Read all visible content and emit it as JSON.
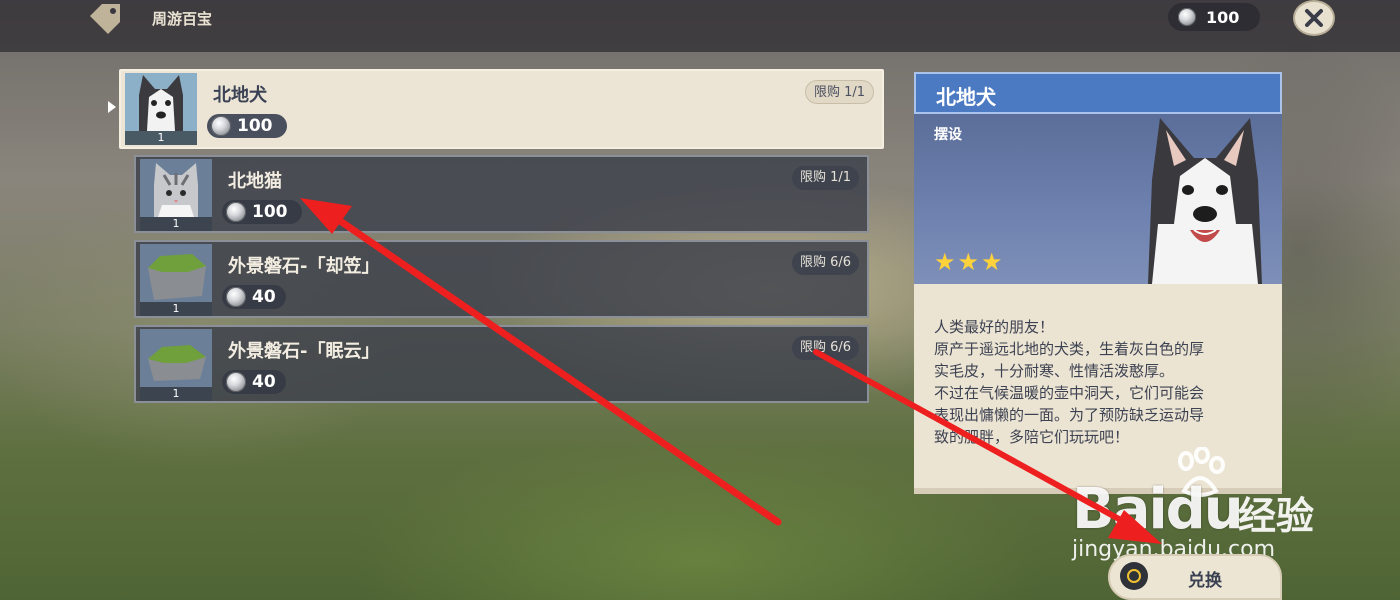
{
  "header": {
    "shop_title": "周游百宝",
    "currency_amount": "100",
    "icons": {
      "tag": "price-tag-icon",
      "coin": "silver-coin-icon",
      "close": "close-icon"
    }
  },
  "items": [
    {
      "name": "北地犬",
      "price": "100",
      "limit": "限购 1/1",
      "count": "1",
      "selected": true
    },
    {
      "name": "北地猫",
      "price": "100",
      "limit": "限购 1/1",
      "count": "1",
      "selected": false
    },
    {
      "name": "外景磐石-「却笠」",
      "price": "40",
      "limit": "限购 6/6",
      "count": "1",
      "selected": false
    },
    {
      "name": "外景磐石-「眠云」",
      "price": "40",
      "limit": "限购 6/6",
      "count": "1",
      "selected": false
    }
  ],
  "detail": {
    "title": "北地犬",
    "category": "摆设",
    "stars": "★★★",
    "description": [
      "人类最好的朋友！",
      "原产于遥远北地的犬类，生着灰白色的厚",
      "实毛皮，十分耐寒、性情活泼憨厚。",
      "不过在气候温暖的壶中洞天，它们可能会",
      "表现出慵懒的一面。为了预防缺乏运动导",
      "致的肥胖，多陪它们玩玩吧！"
    ]
  },
  "exchange_button": {
    "label": "兑换"
  },
  "watermark": {
    "brand": "Baidu",
    "suffix": "经验",
    "url": "jingyan.baidu.com"
  },
  "colors": {
    "annotation_arrow": "#ee1f1f",
    "selected_item_bg": "#ece5d5",
    "detail_header": "#4b7ac2",
    "star": "#ffd13a"
  }
}
